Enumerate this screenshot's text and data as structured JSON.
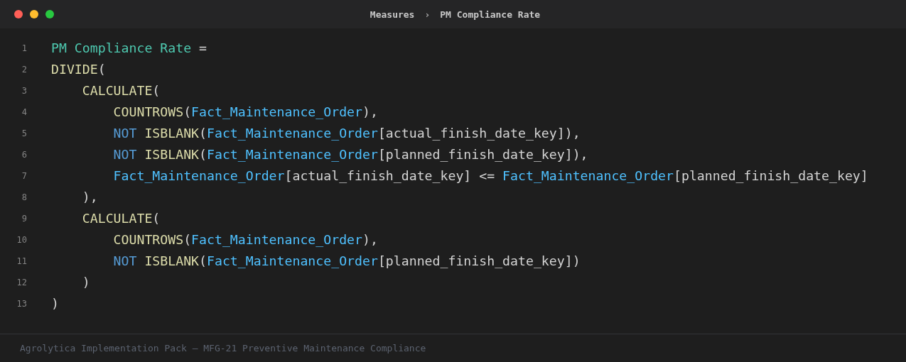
{
  "window": {
    "controls": [
      {
        "kind": "close"
      },
      {
        "kind": "minimize"
      },
      {
        "kind": "maximize"
      }
    ],
    "breadcrumb": [
      "Measures",
      "›",
      "PM Compliance Rate"
    ]
  },
  "editor": {
    "lines": [
      {
        "number": "1",
        "tokens": [
          {
            "kind": "measure",
            "text": "PM Compliance Rate"
          },
          {
            "kind": "plain",
            "text": " ="
          }
        ]
      },
      {
        "number": "2",
        "tokens": [
          {
            "kind": "function",
            "text": "DIVIDE"
          },
          {
            "kind": "plain",
            "text": "("
          }
        ]
      },
      {
        "number": "3",
        "tokens": [
          {
            "kind": "function",
            "text": "    CALCULATE"
          },
          {
            "kind": "plain",
            "text": "("
          }
        ]
      },
      {
        "number": "4",
        "tokens": [
          {
            "kind": "function",
            "text": "        COUNTROWS"
          },
          {
            "kind": "plain",
            "text": "("
          },
          {
            "kind": "table",
            "text": "Fact_Maintenance_Order"
          },
          {
            "kind": "plain",
            "text": "),"
          }
        ]
      },
      {
        "number": "5",
        "tokens": [
          {
            "kind": "keyword",
            "text": "        NOT"
          },
          {
            "kind": "function",
            "text": " ISBLANK"
          },
          {
            "kind": "plain",
            "text": "("
          },
          {
            "kind": "table",
            "text": "Fact_Maintenance_Order"
          },
          {
            "kind": "plain",
            "text": "[actual_finish_date_key]),"
          }
        ]
      },
      {
        "number": "6",
        "tokens": [
          {
            "kind": "keyword",
            "text": "        NOT"
          },
          {
            "kind": "function",
            "text": " ISBLANK"
          },
          {
            "kind": "plain",
            "text": "("
          },
          {
            "kind": "table",
            "text": "Fact_Maintenance_Order"
          },
          {
            "kind": "plain",
            "text": "[planned_finish_date_key]),"
          }
        ]
      },
      {
        "number": "7",
        "tokens": [
          {
            "kind": "table",
            "text": "        Fact_Maintenance_Order"
          },
          {
            "kind": "plain",
            "text": "[actual_finish_date_key] <= "
          },
          {
            "kind": "table",
            "text": "Fact_Maintenance_Order"
          },
          {
            "kind": "plain",
            "text": "[planned_finish_date_key]"
          }
        ]
      },
      {
        "number": "8",
        "tokens": [
          {
            "kind": "plain",
            "text": "    ),"
          }
        ]
      },
      {
        "number": "9",
        "tokens": [
          {
            "kind": "function",
            "text": "    CALCULATE"
          },
          {
            "kind": "plain",
            "text": "("
          }
        ]
      },
      {
        "number": "10",
        "tokens": [
          {
            "kind": "function",
            "text": "        COUNTROWS"
          },
          {
            "kind": "plain",
            "text": "("
          },
          {
            "kind": "table",
            "text": "Fact_Maintenance_Order"
          },
          {
            "kind": "plain",
            "text": "),"
          }
        ]
      },
      {
        "number": "11",
        "tokens": [
          {
            "kind": "keyword",
            "text": "        NOT"
          },
          {
            "kind": "function",
            "text": " ISBLANK"
          },
          {
            "kind": "plain",
            "text": "("
          },
          {
            "kind": "table",
            "text": "Fact_Maintenance_Order"
          },
          {
            "kind": "plain",
            "text": "[planned_finish_date_key])"
          }
        ]
      },
      {
        "number": "12",
        "tokens": [
          {
            "kind": "plain",
            "text": "    )"
          }
        ]
      },
      {
        "number": "13",
        "tokens": [
          {
            "kind": "plain",
            "text": ")"
          }
        ]
      }
    ]
  },
  "footer": "Agrolytica Implementation Pack — MFG-21 Preventive Maintenance Compliance"
}
